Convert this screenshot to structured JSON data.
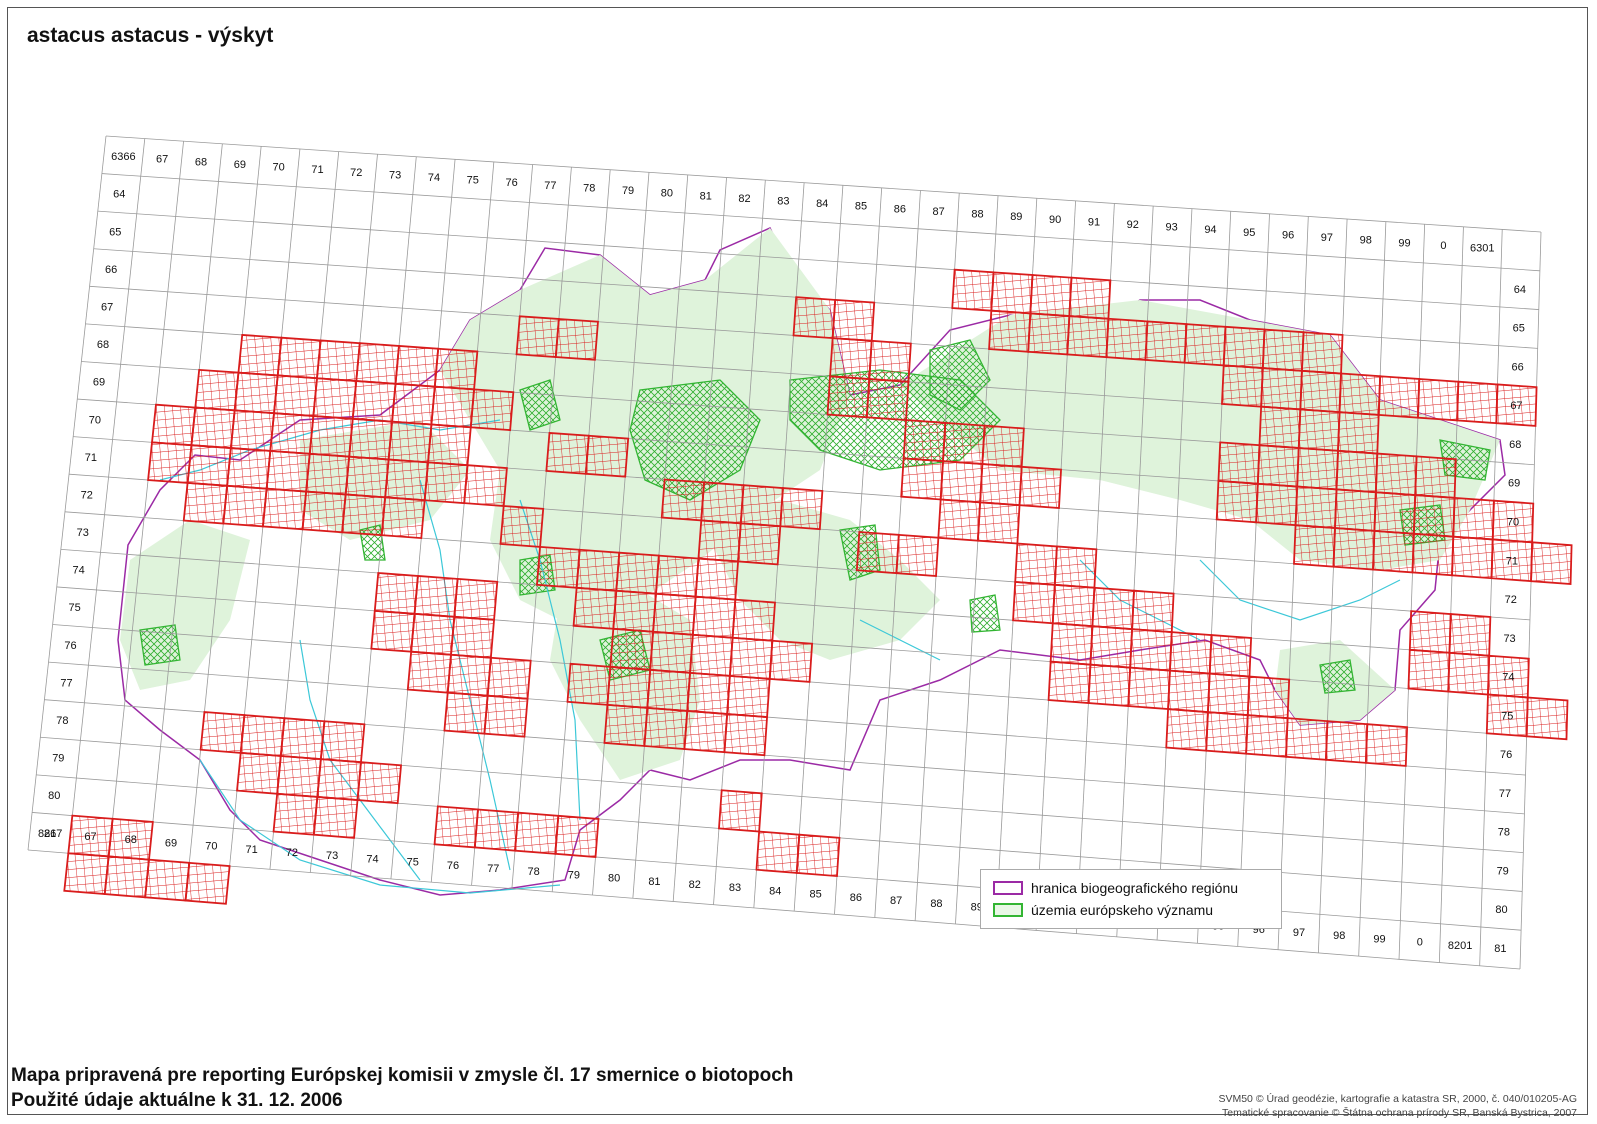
{
  "title": "astacus astacus - výskyt",
  "footer": {
    "line1": "Mapa pripravená pre reporting Európskej komisii v zmysle čl. 17 smernice o biotopoch",
    "line2": "Použité údaje aktuálne k 31. 12. 2006"
  },
  "credits": {
    "line1": "SVM50 © Úrad geodézie, kartografie a katastra SR, 2000, č. 040/010205-AG",
    "line2": "Tematické spracovanie © Štátna ochrana prírody SR, Banská Bystrica, 2007"
  },
  "legend": {
    "border_label": "hranica biogeografického regiónu",
    "sites_label": "územia európskeho významu"
  },
  "grid": {
    "top_labels": [
      "6366",
      "67",
      "68",
      "69",
      "70",
      "71",
      "72",
      "73",
      "74",
      "75",
      "76",
      "77",
      "78",
      "79",
      "80",
      "81",
      "82",
      "83",
      "84",
      "85",
      "86",
      "87",
      "88",
      "89",
      "90",
      "91",
      "92",
      "93",
      "94",
      "95",
      "96",
      "97",
      "98",
      "99",
      "0",
      "6301"
    ],
    "bottom_labels": [
      "8267",
      "67",
      "68",
      "69",
      "70",
      "71",
      "72",
      "73",
      "74",
      "75",
      "76",
      "77",
      "78",
      "79",
      "80",
      "81",
      "82",
      "83",
      "84",
      "85",
      "86",
      "87",
      "88",
      "89",
      "90",
      "91",
      "92",
      "93",
      "94",
      "95",
      "96",
      "97",
      "98",
      "99",
      "0",
      "8201"
    ],
    "left_labels": [
      "64",
      "65",
      "66",
      "67",
      "68",
      "69",
      "70",
      "71",
      "72",
      "73",
      "74",
      "75",
      "76",
      "77",
      "78",
      "79",
      "80",
      "81"
    ],
    "right_labels": [
      "64",
      "65",
      "66",
      "67",
      "68",
      "69",
      "70",
      "71",
      "72",
      "73",
      "74",
      "75",
      "76",
      "77",
      "78",
      "79",
      "80",
      "81"
    ]
  },
  "colors": {
    "occurrence": "#d91c1c",
    "region_border": "#9b2aa5",
    "sites": "#33b533",
    "sites_fill": "#dff3db",
    "rivers": "#3cc8d8",
    "grid": "#9a9a9a"
  },
  "occurrence_squares": [
    [
      0,
      17
    ],
    [
      1,
      17
    ],
    [
      0,
      18
    ],
    [
      1,
      18
    ],
    [
      2,
      18
    ],
    [
      3,
      18
    ],
    [
      3,
      4
    ],
    [
      4,
      4
    ],
    [
      5,
      4
    ],
    [
      6,
      4
    ],
    [
      7,
      4
    ],
    [
      8,
      4
    ],
    [
      2,
      5
    ],
    [
      3,
      5
    ],
    [
      4,
      5
    ],
    [
      5,
      5
    ],
    [
      6,
      5
    ],
    [
      7,
      5
    ],
    [
      8,
      5
    ],
    [
      9,
      5
    ],
    [
      1,
      6
    ],
    [
      2,
      6
    ],
    [
      3,
      6
    ],
    [
      4,
      6
    ],
    [
      5,
      6
    ],
    [
      6,
      6
    ],
    [
      7,
      6
    ],
    [
      8,
      6
    ],
    [
      1,
      7
    ],
    [
      2,
      7
    ],
    [
      3,
      7
    ],
    [
      4,
      7
    ],
    [
      5,
      7
    ],
    [
      6,
      7
    ],
    [
      7,
      7
    ],
    [
      8,
      7
    ],
    [
      9,
      7
    ],
    [
      2,
      8
    ],
    [
      3,
      8
    ],
    [
      4,
      8
    ],
    [
      5,
      8
    ],
    [
      6,
      8
    ],
    [
      7,
      8
    ],
    [
      11,
      9
    ],
    [
      12,
      9
    ],
    [
      13,
      9
    ],
    [
      14,
      9
    ],
    [
      15,
      9
    ],
    [
      12,
      10
    ],
    [
      13,
      10
    ],
    [
      14,
      10
    ],
    [
      15,
      10
    ],
    [
      16,
      10
    ],
    [
      13,
      11
    ],
    [
      14,
      11
    ],
    [
      15,
      11
    ],
    [
      16,
      11
    ],
    [
      17,
      11
    ],
    [
      12,
      12
    ],
    [
      13,
      12
    ],
    [
      14,
      12
    ],
    [
      15,
      12
    ],
    [
      16,
      12
    ],
    [
      13,
      13
    ],
    [
      14,
      13
    ],
    [
      15,
      13
    ],
    [
      16,
      13
    ],
    [
      14,
      7
    ],
    [
      15,
      7
    ],
    [
      16,
      7
    ],
    [
      17,
      7
    ],
    [
      15,
      8
    ],
    [
      16,
      8
    ],
    [
      23,
      8
    ],
    [
      24,
      8
    ],
    [
      23,
      9
    ],
    [
      24,
      9
    ],
    [
      25,
      9
    ],
    [
      26,
      9
    ],
    [
      24,
      10
    ],
    [
      25,
      10
    ],
    [
      26,
      10
    ],
    [
      27,
      10
    ],
    [
      28,
      10
    ],
    [
      24,
      11
    ],
    [
      25,
      11
    ],
    [
      26,
      11
    ],
    [
      27,
      11
    ],
    [
      28,
      11
    ],
    [
      29,
      11
    ],
    [
      29,
      4
    ],
    [
      30,
      4
    ],
    [
      31,
      4
    ],
    [
      28,
      5
    ],
    [
      29,
      5
    ],
    [
      30,
      5
    ],
    [
      31,
      5
    ],
    [
      32,
      5
    ],
    [
      33,
      5
    ],
    [
      28,
      6
    ],
    [
      29,
      6
    ],
    [
      30,
      6
    ],
    [
      31,
      6
    ],
    [
      32,
      6
    ],
    [
      33,
      6
    ],
    [
      34,
      6
    ],
    [
      35,
      6
    ],
    [
      30,
      7
    ],
    [
      31,
      7
    ],
    [
      32,
      7
    ],
    [
      33,
      7
    ],
    [
      34,
      7
    ],
    [
      35,
      7
    ],
    [
      36,
      7
    ],
    [
      27,
      2
    ],
    [
      28,
      2
    ],
    [
      29,
      2
    ],
    [
      30,
      2
    ],
    [
      28,
      3
    ],
    [
      29,
      3
    ],
    [
      30,
      3
    ],
    [
      31,
      3
    ],
    [
      32,
      3
    ],
    [
      33,
      3
    ],
    [
      34,
      3
    ],
    [
      35,
      3
    ],
    [
      33,
      9
    ],
    [
      34,
      9
    ],
    [
      33,
      10
    ],
    [
      34,
      10
    ],
    [
      35,
      10
    ],
    [
      35,
      11
    ],
    [
      36,
      11
    ],
    [
      7,
      10
    ],
    [
      8,
      10
    ],
    [
      9,
      10
    ],
    [
      7,
      11
    ],
    [
      8,
      11
    ],
    [
      9,
      11
    ],
    [
      8,
      12
    ],
    [
      9,
      12
    ],
    [
      10,
      12
    ],
    [
      9,
      13
    ],
    [
      10,
      13
    ],
    [
      3,
      14
    ],
    [
      4,
      14
    ],
    [
      5,
      14
    ],
    [
      6,
      14
    ],
    [
      4,
      15
    ],
    [
      5,
      15
    ],
    [
      6,
      15
    ],
    [
      7,
      15
    ],
    [
      5,
      16
    ],
    [
      6,
      16
    ],
    [
      18,
      3
    ],
    [
      19,
      3
    ],
    [
      18,
      4
    ],
    [
      19,
      4
    ],
    [
      20,
      5
    ],
    [
      21,
      5
    ],
    [
      22,
      5
    ],
    [
      20,
      6
    ],
    [
      21,
      6
    ],
    [
      22,
      6
    ],
    [
      23,
      6
    ],
    [
      21,
      7
    ],
    [
      22,
      7
    ],
    [
      21,
      1
    ],
    [
      22,
      1
    ],
    [
      23,
      1
    ],
    [
      24,
      1
    ],
    [
      22,
      2
    ],
    [
      23,
      2
    ],
    [
      24,
      2
    ],
    [
      25,
      2
    ],
    [
      26,
      2
    ],
    [
      19,
      8
    ],
    [
      20,
      8
    ],
    [
      10,
      3
    ],
    [
      11,
      3
    ],
    [
      17,
      2
    ],
    [
      18,
      2
    ],
    [
      11,
      6
    ],
    [
      12,
      6
    ],
    [
      10,
      8
    ],
    [
      16,
      15
    ],
    [
      17,
      16
    ],
    [
      18,
      16
    ],
    [
      9,
      16
    ],
    [
      10,
      16
    ],
    [
      11,
      16
    ],
    [
      12,
      16
    ],
    [
      27,
      12
    ],
    [
      28,
      12
    ],
    [
      29,
      12
    ],
    [
      30,
      12
    ],
    [
      31,
      12
    ],
    [
      32,
      12
    ]
  ]
}
